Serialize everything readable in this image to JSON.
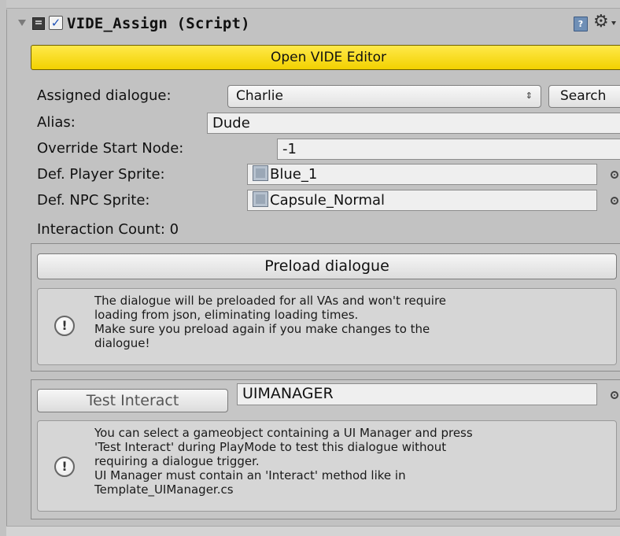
{
  "component": {
    "title": "VIDE_Assign (Script)",
    "enabled": true,
    "check_glyph": "✓",
    "icons": [
      "foldout-arrow-icon",
      "script-icon",
      "book-icon",
      "gear-icon"
    ]
  },
  "open_editor": {
    "label": "Open VIDE Editor",
    "color": "#f2d100"
  },
  "fields": {
    "assigned_dialogue": {
      "label": "Assigned dialogue:",
      "value": "Charlie",
      "arrow": "⇕"
    },
    "search_label": "Search",
    "alias": {
      "label": "Alias:",
      "value": "Dude"
    },
    "override_start": {
      "label": "Override Start Node:",
      "value": "-1"
    },
    "player_sprite": {
      "label": "Def. Player Sprite:",
      "value": "Blue_1"
    },
    "npc_sprite": {
      "label": "Def. NPC Sprite:",
      "value": "Capsule_Normal"
    },
    "interaction_count": "Interaction Count: 0"
  },
  "preload": {
    "button_label": "Preload dialogue",
    "help_lines": [
      "The dialogue will be preloaded for all VAs and won't require",
      "loading from json, eliminating loading times.",
      "Make sure you preload again if you make changes to the",
      "dialogue!"
    ]
  },
  "test": {
    "button_label": "Test Interact",
    "object_value": "UIMANAGER",
    "help_lines": [
      "You can select a gameobject containing a UI Manager and press",
      "'Test Interact' during PlayMode to test this dialogue without",
      "requiring a dialogue trigger.",
      "UI Manager must contain an 'Interact' method like in",
      "Template_UIManager.cs"
    ]
  }
}
